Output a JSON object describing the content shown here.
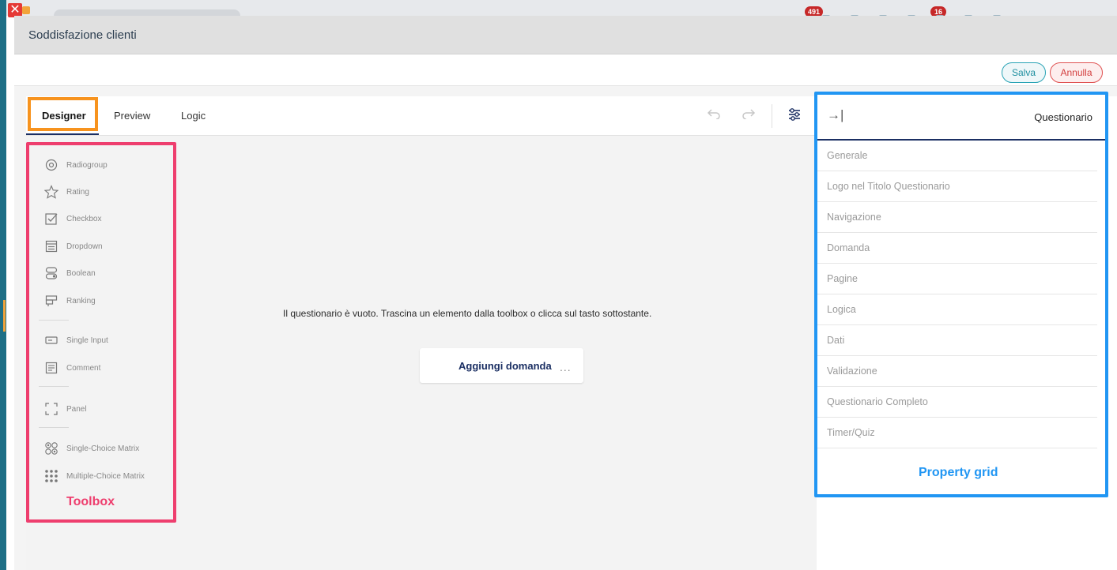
{
  "background": {
    "badges": [
      "491",
      "16"
    ]
  },
  "dialog": {
    "title": "Soddisfazione clienti",
    "save_label": "Salva",
    "cancel_label": "Annulla"
  },
  "tabs": [
    {
      "label": "Designer",
      "active": true
    },
    {
      "label": "Preview",
      "active": false
    },
    {
      "label": "Logic",
      "active": false
    }
  ],
  "toolbar_icons": [
    "undo-icon",
    "redo-icon",
    "settings-icon"
  ],
  "toolbox": {
    "title": "Toolbox",
    "items": [
      {
        "label": "Radiogroup",
        "icon": "radiogroup-icon"
      },
      {
        "label": "Rating",
        "icon": "star-icon"
      },
      {
        "label": "Checkbox",
        "icon": "checkbox-icon"
      },
      {
        "label": "Dropdown",
        "icon": "dropdown-icon"
      },
      {
        "label": "Boolean",
        "icon": "boolean-icon"
      },
      {
        "label": "Ranking",
        "icon": "ranking-icon"
      },
      {
        "label": "Single Input",
        "icon": "single-input-icon"
      },
      {
        "label": "Comment",
        "icon": "comment-icon"
      },
      {
        "label": "Panel",
        "icon": "panel-icon"
      },
      {
        "label": "Single-Choice Matrix",
        "icon": "single-choice-matrix-icon"
      },
      {
        "label": "Multiple-Choice Matrix",
        "icon": "multiple-choice-matrix-icon"
      }
    ]
  },
  "surface": {
    "empty_message": "Il questionario è vuoto. Trascina un elemento dalla toolbox o clicca sul tasto sottostante.",
    "add_question_label": "Aggiungi domanda",
    "more_label": "..."
  },
  "property_grid": {
    "title": "Questionario",
    "label": "Property grid",
    "sections": [
      "Generale",
      "Logo nel Titolo Questionario",
      "Navigazione",
      "Domanda",
      "Pagine",
      "Logica",
      "Dati",
      "Validazione",
      "Questionario Completo",
      "Timer/Quiz"
    ]
  },
  "colors": {
    "toolbox_highlight": "#ee3e6e",
    "designer_tab_highlight": "#f7931e",
    "property_grid_highlight": "#2196f3",
    "accent_navy": "#1b2f63"
  }
}
